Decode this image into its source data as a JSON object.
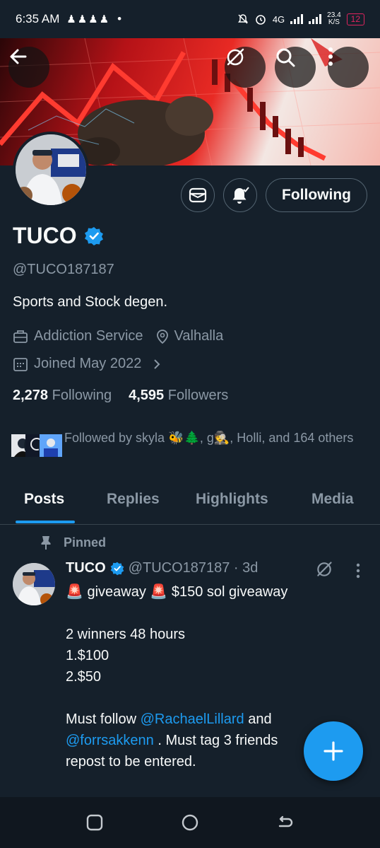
{
  "status_bar": {
    "time": "6:35 AM",
    "notification_icons": "♟♟♟♟",
    "dot": "•",
    "network_type": "4G",
    "speed_value": "23.4",
    "speed_unit": "K/S",
    "battery": "12"
  },
  "banner": {
    "colors": {
      "red": "#e82a24",
      "dark": "#2a0608",
      "light": "#f3e7e3"
    }
  },
  "profile": {
    "name": "TUCO",
    "handle": "@TUCO187187",
    "bio": "Sports and Stock degen.",
    "category": "Addiction Service",
    "location": "Valhalla",
    "joined": "Joined May 2022",
    "following_count": "2,278",
    "following_label": "Following",
    "followers_count": "4,595",
    "followers_label": "Followers",
    "follow_button": "Following",
    "followed_by": "Followed by skyla 🐝🌲, g🕵, Holli, and 164 others",
    "verified_color": "#1d9bf0"
  },
  "tabs": [
    "Posts",
    "Replies",
    "Highlights",
    "Media"
  ],
  "pinned_post": {
    "pinned_label": "Pinned",
    "author": "TUCO",
    "handle_time": "@TUCO187187 · 3d",
    "line1": "🚨 giveaway 🚨 $150 sol giveaway",
    "line2": "2 winners 48 hours",
    "line3": "1.$100",
    "line4": "2.$50",
    "line5_pre": "Must follow ",
    "mention1": "@RachaelLillard",
    "line5_post": " and",
    "mention2": "@forrsakkenn",
    "line6_post": " . Must tag 3 friends",
    "line7": "repost to be entered."
  },
  "fab": {
    "icon": "plus-icon",
    "color": "#1d9bf0"
  },
  "nav_bar": {
    "icons": [
      "recents-icon",
      "home-icon",
      "back-icon"
    ]
  }
}
